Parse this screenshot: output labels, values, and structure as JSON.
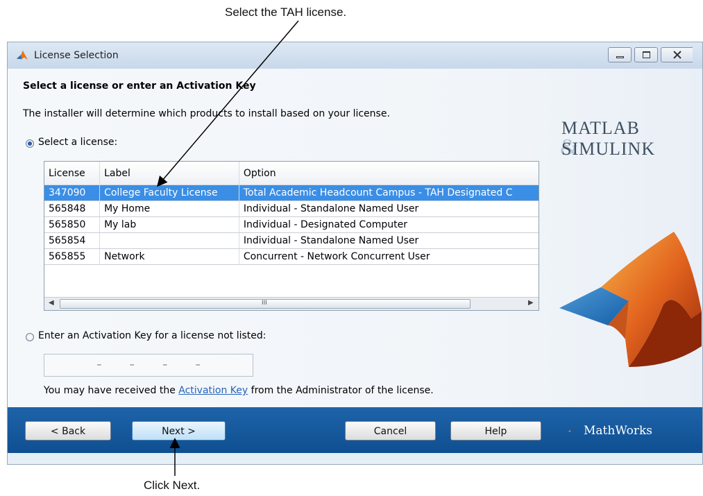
{
  "callouts": {
    "top": "Select the TAH license.",
    "bottom": "Click Next."
  },
  "window": {
    "title": "License Selection",
    "controls": [
      "minimize",
      "maximize",
      "close"
    ]
  },
  "content": {
    "heading": "Select a license or enter an Activation Key",
    "subtext": "The installer will determine which products to install based on your license.",
    "select_license_label": "Select a license:",
    "select_license_checked": true,
    "table": {
      "headers": [
        "License",
        "Label",
        "Option"
      ],
      "rows": [
        {
          "license": "347090",
          "label": "College Faculty License",
          "option": "Total Academic Headcount Campus - TAH Designated C",
          "selected": true
        },
        {
          "license": "565848",
          "label": "My Home",
          "option": "Individual - Standalone Named User",
          "selected": false
        },
        {
          "license": "565850",
          "label": "My lab",
          "option": "Individual - Designated Computer",
          "selected": false
        },
        {
          "license": "565854",
          "label": "",
          "option": "Individual - Standalone Named User",
          "selected": false
        },
        {
          "license": "565855",
          "label": "Network",
          "option": "Concurrent - Network Concurrent User",
          "selected": false
        }
      ],
      "scroll_grip": "III"
    },
    "activation_key_label": "Enter an Activation Key for a license not listed:",
    "activation_key_checked": false,
    "activation_key_value": "– – – –",
    "note_prefix": "You may have received the ",
    "note_link": "Activation Key",
    "note_suffix": " from the Administrator of the license."
  },
  "branding": {
    "matlab": "MATLAB",
    "simulink": "SIMULINK",
    "mathworks": "MathWorks"
  },
  "buttons": {
    "back": "< Back",
    "next": "Next >",
    "cancel": "Cancel",
    "help": "Help"
  },
  "colors": {
    "footer_blue": "#1e63a9",
    "selection_blue": "#3a8ee6",
    "next_button": "#bfe0f8"
  }
}
